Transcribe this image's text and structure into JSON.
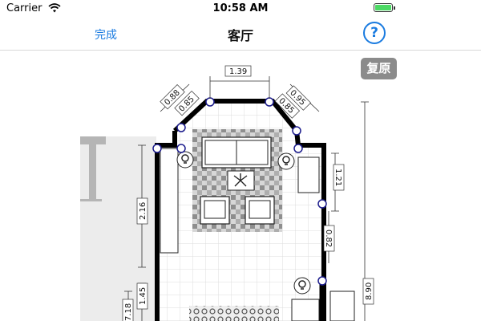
{
  "status_bar": {
    "carrier": "Carrier",
    "time": "10:58 AM",
    "battery_level": 1.0
  },
  "nav": {
    "done_label": "完成",
    "title": "客厅",
    "help_label": "?"
  },
  "reset_label": "复原",
  "dimensions": {
    "top_wall": "1.39",
    "left_diag_outer": "0.88",
    "left_diag_inner": "0.85",
    "right_diag_outer": "0.95",
    "right_diag_inner": "0.85",
    "left_wall": "2.16",
    "right_wall_upper": "1.21",
    "right_wall_mid": "0.82",
    "lower_left_a": "1.45",
    "lower_left_b": "7.18",
    "overall_right": "8.90"
  },
  "colors": {
    "accent": "#1a7be0",
    "handle": "#1c1c8c",
    "wall": "#000000",
    "reset_bg": "#8b8b8b"
  }
}
